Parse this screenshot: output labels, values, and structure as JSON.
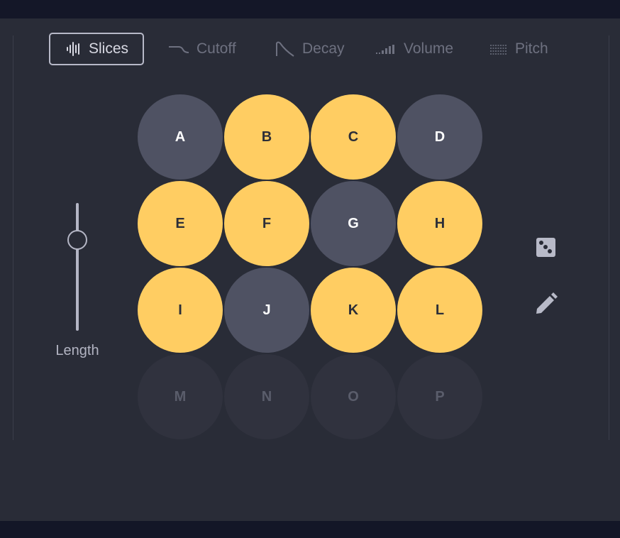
{
  "tabs": [
    {
      "label": "Slices",
      "icon": "waveform-icon",
      "active": true
    },
    {
      "label": "Cutoff",
      "icon": "cutoff-curve-icon",
      "active": false
    },
    {
      "label": "Decay",
      "icon": "decay-curve-icon",
      "active": false
    },
    {
      "label": "Volume",
      "icon": "volume-bars-icon",
      "active": false
    },
    {
      "label": "Pitch",
      "icon": "pitch-lines-icon",
      "active": false
    }
  ],
  "length_slider": {
    "label": "Length",
    "value_fraction": 0.75
  },
  "pads": [
    {
      "label": "A",
      "state": "off"
    },
    {
      "label": "B",
      "state": "on"
    },
    {
      "label": "C",
      "state": "on"
    },
    {
      "label": "D",
      "state": "off"
    },
    {
      "label": "E",
      "state": "on"
    },
    {
      "label": "F",
      "state": "on"
    },
    {
      "label": "G",
      "state": "off"
    },
    {
      "label": "H",
      "state": "on"
    },
    {
      "label": "I",
      "state": "on"
    },
    {
      "label": "J",
      "state": "off"
    },
    {
      "label": "K",
      "state": "on"
    },
    {
      "label": "L",
      "state": "on"
    },
    {
      "label": "M",
      "state": "disabled"
    },
    {
      "label": "N",
      "state": "disabled"
    },
    {
      "label": "O",
      "state": "disabled"
    },
    {
      "label": "P",
      "state": "disabled"
    }
  ],
  "tools": {
    "randomize_icon": "dice-icon",
    "draw_icon": "pencil-icon"
  },
  "colors": {
    "pad_on": "#ffcd62",
    "pad_off": "#4f5263",
    "pad_disabled": "#30323e",
    "panel": "#292c37"
  }
}
